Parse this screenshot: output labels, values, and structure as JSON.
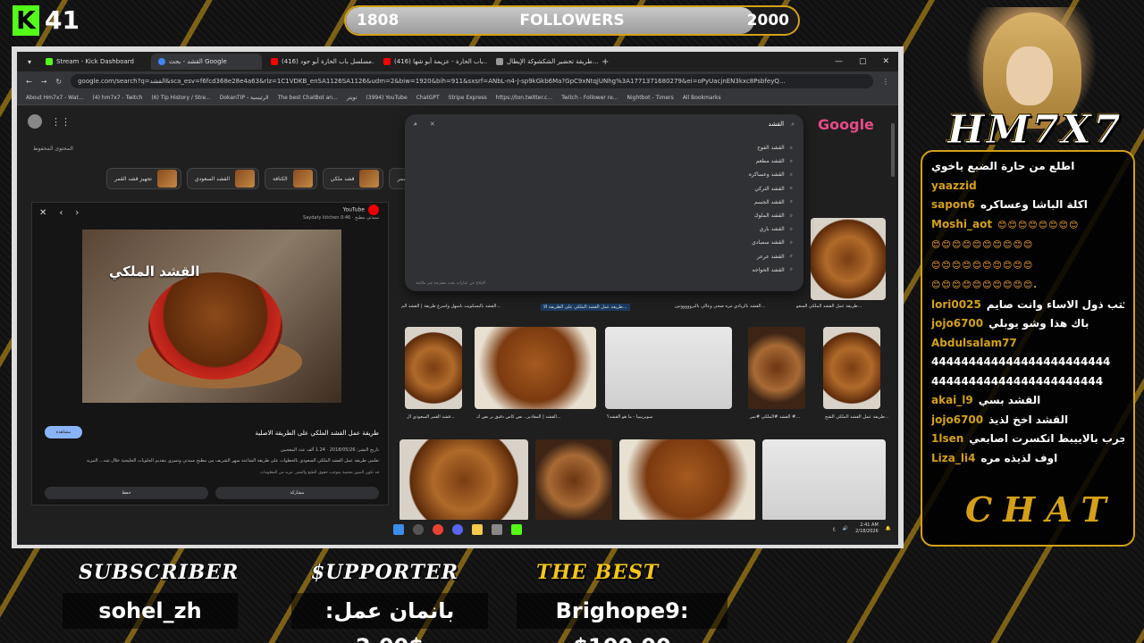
{
  "overlay": {
    "kick_count": "41",
    "followers": {
      "current": "1808",
      "label": "FOLLOWERS",
      "goal": "2000",
      "progress": 0.904
    },
    "streamer_logo": "HM7X7",
    "chat_logo": "CHAT",
    "bottom": {
      "subscriber_label": "SUBSCRIBER",
      "subscriber_value": "sohel_zh",
      "supporter_label": "$UPPORTER",
      "supporter_value": "بانمان عمل: 2.00$",
      "best_label": "THE BEST",
      "best_value": "Brighope9: $100.00"
    }
  },
  "browser": {
    "tabs": [
      {
        "label": "Stream - Kick Dashboard",
        "color": "#53fc18"
      },
      {
        "label": "القشد - بحث Google",
        "color": "#4285f4"
      },
      {
        "label": "(416) مسلسل باب الحارة أبو جود...",
        "color": "#ff0000"
      },
      {
        "label": "(416) باب الحارة - عزيمة أبو شها...",
        "color": "#ff0000"
      },
      {
        "label": "طريقة تحضير الشكشوكة الإيطال...",
        "color": "#999999"
      }
    ],
    "url": "google.com/search?q=القشد&sca_esv=f6fcd368e28e4a63&rlz=1C1VDKB_enSA1126SA1126&udm=2&biw=1920&bih=911&sxsrf=ANbL-n4-J-sp9kGkb6Ma?GpC9xNtqjUNhg%3A1771371680279&ei=oPyUacjnEN3kxc8PsbfeyQ...",
    "bookmarks": [
      "About Hm7x7 - Wat...",
      "(4) hm7x7 - Twitch",
      "(6) Tip History / Stre...",
      "DokanTIP - الرئيسية",
      "The best ChatBot an...",
      "تويتر",
      "(3994) YouTube",
      "ChatGPT",
      "Stripe Express",
      "https://ton.twitter.c...",
      "Twitch - Follower re...",
      "Nightbot - Timers",
      "All Bookmarks"
    ],
    "saved_label": "المحتوى المحفوظ",
    "google_logo": "Google",
    "chips": [
      "بالفرن الأسمر",
      "قشد ملكي",
      "الكنافة",
      "القشد السعودي",
      "تجهيز قشد القمر"
    ],
    "search": {
      "query": "القشد",
      "suggestions": [
        "القشد الفوح",
        "القشد مطعم",
        "القشد وعساكره",
        "القشد التركي",
        "القشد الجسم",
        "القشد الملوك",
        "القشد باري",
        "القشد سمبادي",
        "القشد عرعر",
        "القشد الحواجه"
      ],
      "footer": "الإبلاغ عن عبارات بحث مقترحة غير ملائمة"
    },
    "panel": {
      "source": "YouTube",
      "channel": "Saydaty kitchen سيدتي مطبخ · 0:46",
      "image_caption": "القشد الملكي",
      "title": "طريقة عمل القشد الملكي على الطريقة الاصلية",
      "date": "تاريخ النشر: 2018/05/26 · 1.24 ألف عدد المعجبين",
      "desc": "تعلمي طريقة عمل القشد الملكي السعودي بالخطوات على طريقة الشاعنة سهر الشريف من مطبخ سيدتي وتميزي بتقديم الحلويات الخليجية خلال شه... المزيد",
      "desc2": "قد تكون الصور محمية بموجب حقوق الطبع والنشر. مزيد من المعلومات",
      "visit": "مشاهدة",
      "save": "حفظ",
      "share": "مشاركة"
    },
    "results": {
      "row1_captions": [
        {
          "src": "YouTube",
          "text": "القشد بالبسكويت باسهل واسرع طريقة | القشد الم..."
        },
        {
          "src": "YouTube",
          "text": "طريقة عمل القشد الملكي على الطريقة الا..."
        },
        {
          "src": "x.com",
          "text": "القشد بالزيادي مره صحي وعالي بالبروووووتين..."
        },
        {
          "src": "مطبخ سيدتي",
          "text": "طريقة عمل القشد الملكي السعو..."
        }
      ],
      "row2_captions": [
        {
          "src": "Instagram",
          "text": "قشد القمر السعودي ال..."
        },
        {
          "src": "Flickr",
          "text": "القشد | المقادير.. نص كاس دقيق بر نص ك..."
        },
        {
          "src": "سوبربيبيا",
          "text": "سوبربيبيا - ما هو القشد؟"
        },
        {
          "src": "TikTok",
          "text": "القشد #الملكي #نمر #..."
        },
        {
          "src": "TikTok",
          "text": "طريقة عمل القشد الملكي الشح..."
        }
      ]
    },
    "taskbar": {
      "time": "2:41 AM",
      "date": "2/18/2026",
      "lang": "ع"
    }
  },
  "chat": [
    {
      "user": "",
      "text": "اطلع من حارة الضبع ياخوي"
    },
    {
      "user": "yaazzid",
      "text": ""
    },
    {
      "user": "sapon6",
      "text": "اكلة الباشا وعساكره"
    },
    {
      "user": "Moshi_aot",
      "text": "😊😊😊😊😊😊😊😊"
    },
    {
      "user": "",
      "text": "😊😊😊😊😊😊😊😊😊😊"
    },
    {
      "user": "",
      "text": "😊😊😊😊😊😊😊😊😊😊"
    },
    {
      "user": "",
      "text": "😊😊😊😊😊😊😊😊😊😊."
    },
    {
      "user": "lori0025",
      "text": "اتحدى تكتب ذول الاساء وانت صايم"
    },
    {
      "user": "jojo6700",
      "text": "باك هذا وشو يوبلي"
    },
    {
      "user": "Abdulsalam77",
      "text": ""
    },
    {
      "user": "",
      "text": "444444444444444444444444"
    },
    {
      "user": "",
      "text": "44444444444444444444444"
    },
    {
      "user": "akai_l9",
      "text": "القشد بسي"
    },
    {
      "user": "jojo6700",
      "text": "القشد اخخ لذيذ"
    },
    {
      "user": "1lsen",
      "text": "جرب بالاييبط انكسرت اصابعي"
    },
    {
      "user": "Liza_li4",
      "text": "اوف لذيذه مره"
    }
  ],
  "colors": {
    "kick_green": "#53fc18",
    "gold": "#d4a017"
  }
}
